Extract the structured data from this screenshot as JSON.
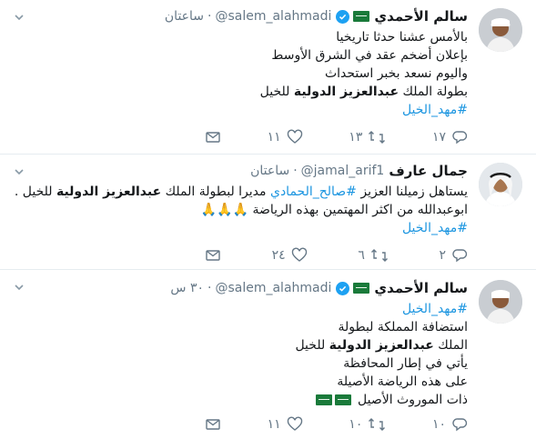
{
  "tweets": [
    {
      "name": "سالم الأحمدي",
      "handle": "@salem_alahmadi",
      "time": "ساعتان",
      "lines": [
        "بالأمس عشنا حدثا تاريخيا",
        "بإعلان أضخم عقد في الشرق الأوسط",
        "واليوم نسعد بخبر استحداث"
      ],
      "line4_pre": "بطولة الملك ",
      "line4_bold": "عبدالعزيز الدولية",
      "line4_post": " للخيل",
      "hashtag": "#مهد_الخيل",
      "replies": "١٧",
      "retweets": "١٣",
      "likes": "١١"
    },
    {
      "name": "جمال عارف",
      "handle": "@jamal_arif1",
      "time": "ساعتان",
      "l1_pre": "يستاهل زميلنا العزيز ",
      "l1_link": "#صالح_الحمادي",
      "l1_mid": " مديرا لبطولة الملك ",
      "l1_bold": "عبدالعزيز الدولية",
      "l1_post": " للخيل .",
      "l2": "ابوعبدالله من اكثر المهتمين بهذه الرياضة",
      "l2_emoji": "🙏🙏🙏",
      "hashtag": "#مهد_الخيل",
      "replies": "٢",
      "retweets": "٦",
      "likes": "٢٤"
    },
    {
      "name": "سالم الأحمدي",
      "handle": "@salem_alahmadi",
      "time": "٣٠ س",
      "hashtag": "#مهد_الخيل",
      "lines": [
        "استضافة المملكة لبطولة"
      ],
      "l3_pre": "الملك ",
      "l3_bold": "عبدالعزيز الدولية",
      "l3_post": " للخيل",
      "lines2": [
        "يأتي في إطار المحافظة",
        "على هذه الرياضة الأصيلة"
      ],
      "last": "ذات الموروث الأصيل",
      "replies": "١٠",
      "retweets": "١٠",
      "likes": "١١"
    }
  ],
  "icons": {
    "accent": "#1da1f2",
    "muted": "#657786",
    "link": "#1b95e0"
  }
}
